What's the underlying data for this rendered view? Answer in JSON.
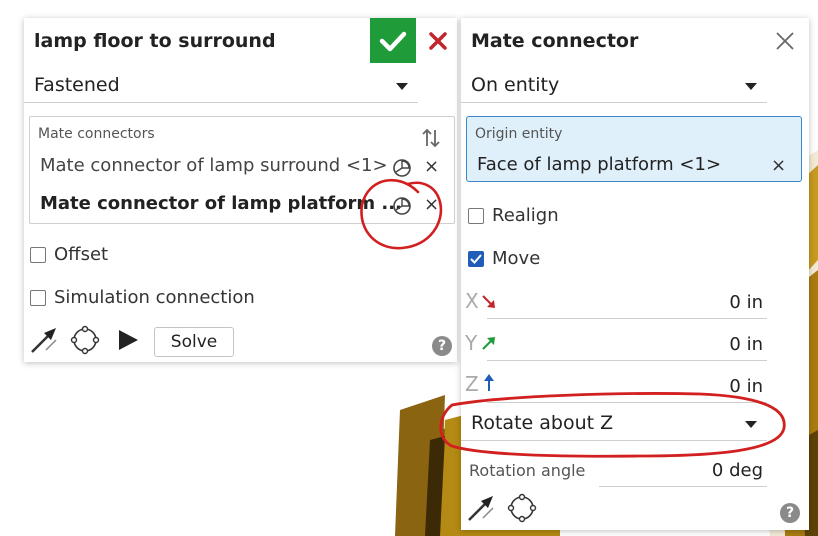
{
  "mate_feature": {
    "title": "lamp floor to surround",
    "type": "Fastened",
    "mate_connectors": {
      "heading": "Mate connectors",
      "items": [
        {
          "label": "Mate connector of lamp surround <1>"
        },
        {
          "label": "Mate connector of lamp platform ..."
        }
      ]
    },
    "offset_label": "Offset",
    "simulation_label": "Simulation connection",
    "solve_label": "Solve",
    "help_glyph": "?"
  },
  "mate_connector": {
    "title": "Mate connector",
    "placement": "On entity",
    "origin_entity_heading": "Origin entity",
    "origin_entity_value": "Face of lamp platform <1>",
    "realign_label": "Realign",
    "move_label": "Move",
    "x_label": "X",
    "x_value": "0 in",
    "y_label": "Y",
    "y_value": "0 in",
    "z_label": "Z",
    "z_value": "0 in",
    "rotate_option": "Rotate about Z",
    "rotation_angle_label": "Rotation angle",
    "rotation_angle_value": "0 deg",
    "help_glyph": "?"
  },
  "colors": {
    "confirm_green": "#1f9b3a",
    "cancel_red": "#c0262c",
    "selection_blue": "#3e86c8",
    "annotation_red": "#d21f1f",
    "model_gold": "#b8860b"
  },
  "close_glyph": "×"
}
